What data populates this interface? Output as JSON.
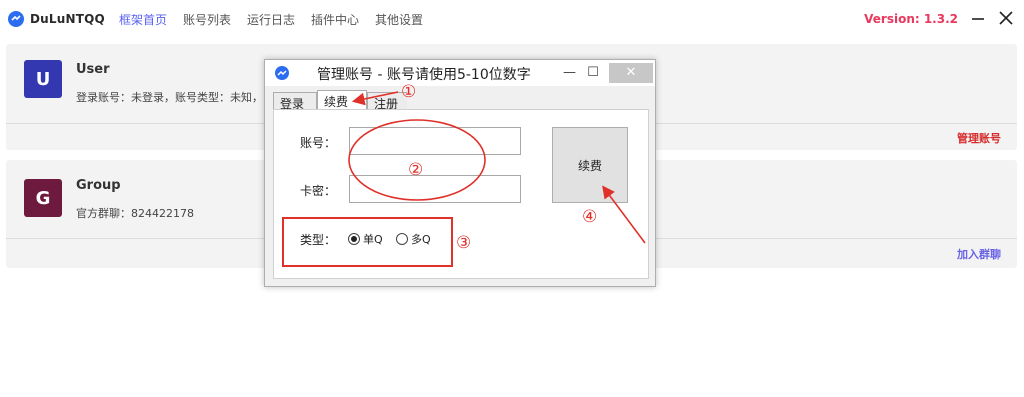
{
  "app": {
    "name": "DuLuNTQQ",
    "nav": [
      "框架首页",
      "账号列表",
      "运行日志",
      "插件中心",
      "其他设置"
    ],
    "active_nav": 0,
    "version": "Version: 1.3.2",
    "minimize_glyph": "—",
    "close_glyph": "✕"
  },
  "user_card": {
    "avatar_letter": "U",
    "title": "User",
    "subtitle": "登录账号：未登录，账号类型：未知，",
    "action": "管理账号",
    "action_color": "#d62c2c"
  },
  "group_card": {
    "avatar_letter": "G",
    "title": "Group",
    "subtitle": "官方群聊：824422178",
    "action": "加入群聊",
    "action_color": "#6a63e6"
  },
  "dialog": {
    "title": "管理账号 - 账号请使用5-10位数字",
    "min_glyph": "—",
    "max_glyph": "☐",
    "close_glyph": "✕",
    "tabs": [
      "登录",
      "续费",
      "注册"
    ],
    "active_tab": 1,
    "account_label": "账号：",
    "account_value": "",
    "card_label": "卡密：",
    "card_value": "",
    "type_label": "类型：",
    "radio_options": [
      "单Q",
      "多Q"
    ],
    "selected_radio": 0,
    "submit_label": "续费"
  },
  "annotations": {
    "markers": [
      "①",
      "②",
      "③",
      "④"
    ],
    "color": "#e0302a"
  }
}
